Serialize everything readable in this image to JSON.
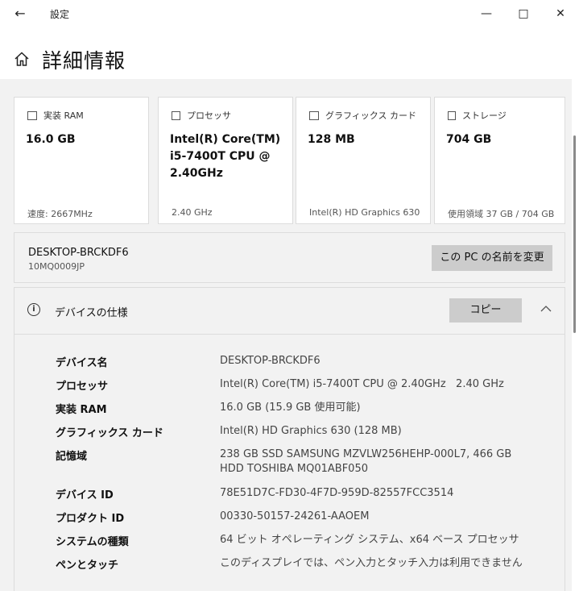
{
  "window": {
    "title": "設定",
    "back_icon": "back-arrow-icon",
    "minimize_icon": "minimize-icon",
    "maximize_icon": "maximize-icon",
    "close_icon": "close-icon"
  },
  "header": {
    "title": "詳細情報",
    "home_icon": "home-icon"
  },
  "cards": [
    {
      "label": "実装 RAM",
      "icon": "memory-icon",
      "value": "16.0 GB",
      "sub": "速度: 2667MHz"
    },
    {
      "label": "プロセッサ",
      "icon": "cpu-icon",
      "value": "Intel(R) Core(TM) i5-7400T CPU @ 2.40GHz",
      "sub": "2.40 GHz"
    },
    {
      "label": "グラフィックス カード",
      "icon": "gpu-icon",
      "value": "128 MB",
      "sub": "Intel(R) HD Graphics 630"
    },
    {
      "label": "ストレージ",
      "icon": "storage-icon",
      "value": "704 GB",
      "sub": "使用領域 37 GB / 704 GB"
    }
  ],
  "pc": {
    "name": "DESKTOP-BRCKDF6",
    "model": "10MQ0009JP",
    "rename_button": "この PC の名前を変更"
  },
  "spec": {
    "title": "デバイスの仕様",
    "icon": "info-icon",
    "copy_button": "コピー",
    "collapse_icon": "chevron-up-icon",
    "rows": [
      {
        "key": "デバイス名",
        "value": "DESKTOP-BRCKDF6"
      },
      {
        "key": "プロセッサ",
        "value": "Intel(R) Core(TM) i5-7400T CPU @ 2.40GHz   2.40 GHz"
      },
      {
        "key": "実装 RAM",
        "value": "16.0 GB (15.9 GB 使用可能)"
      },
      {
        "key": "グラフィックス カード",
        "value": "Intel(R) HD Graphics 630 (128 MB)"
      },
      {
        "key": "記憶域",
        "value": "238 GB SSD SAMSUNG MZVLW256HEHP-000L7, 466 GB HDD TOSHIBA MQ01ABF050"
      },
      {
        "key": "デバイス ID",
        "value": "78E51D7C-FD30-4F7D-959D-82557FCC3514"
      },
      {
        "key": "プロダクト ID",
        "value": "00330-50157-24261-AAOEM"
      },
      {
        "key": "システムの種類",
        "value": "64 ビット オペレーティング システム、x64 ベース プロセッサ"
      },
      {
        "key": "ペンとタッチ",
        "value": "このディスプレイでは、ペン入力とタッチ入力は利用できません"
      }
    ]
  }
}
